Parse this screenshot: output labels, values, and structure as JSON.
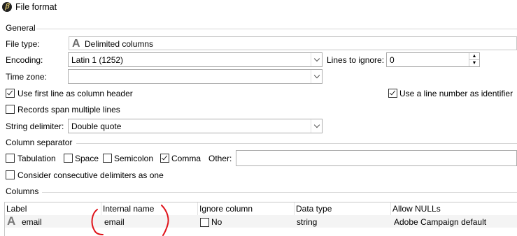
{
  "window": {
    "title": "File format",
    "icon": "adobe-campaign-icon"
  },
  "general": {
    "section_label": "General",
    "file_type": {
      "label": "File type:",
      "value": "Delimited columns",
      "icon": "text-a-icon"
    },
    "encoding": {
      "label": "Encoding:",
      "value": "Latin 1 (1252)"
    },
    "lines_to_ignore": {
      "label": "Lines to ignore:",
      "value": "0"
    },
    "time_zone": {
      "label": "Time zone:",
      "value": ""
    },
    "use_first_line": {
      "label": "Use first line as column header",
      "checked": true
    },
    "line_number_identifier": {
      "label": "Use a line number as identifier",
      "checked": true
    },
    "records_span": {
      "label": "Records span multiple lines",
      "checked": false
    },
    "string_delimiter": {
      "label": "String delimiter:",
      "value": "Double quote"
    }
  },
  "column_separator": {
    "section_label": "Column separator",
    "tabulation": {
      "label": "Tabulation",
      "checked": false
    },
    "space": {
      "label": "Space",
      "checked": false
    },
    "semicolon": {
      "label": "Semicolon",
      "checked": false
    },
    "comma": {
      "label": "Comma",
      "checked": true
    },
    "other": {
      "label": "Other:",
      "value": ""
    },
    "consecutive": {
      "label": "Consider consecutive delimiters as one",
      "checked": false
    }
  },
  "columns": {
    "section_label": "Columns",
    "headers": [
      "Label",
      "Internal name",
      "Ignore column",
      "Data type",
      "Allow NULLs"
    ],
    "rows": [
      {
        "label": "email",
        "internal_name": "email",
        "ignore_label": "No",
        "ignore_checked": false,
        "data_type": "string",
        "allow_nulls": "Adobe Campaign default",
        "icon": "text-a-icon"
      }
    ]
  },
  "annotation": {
    "color": "#e0141b",
    "shape": "handwritten-red-brackets"
  }
}
